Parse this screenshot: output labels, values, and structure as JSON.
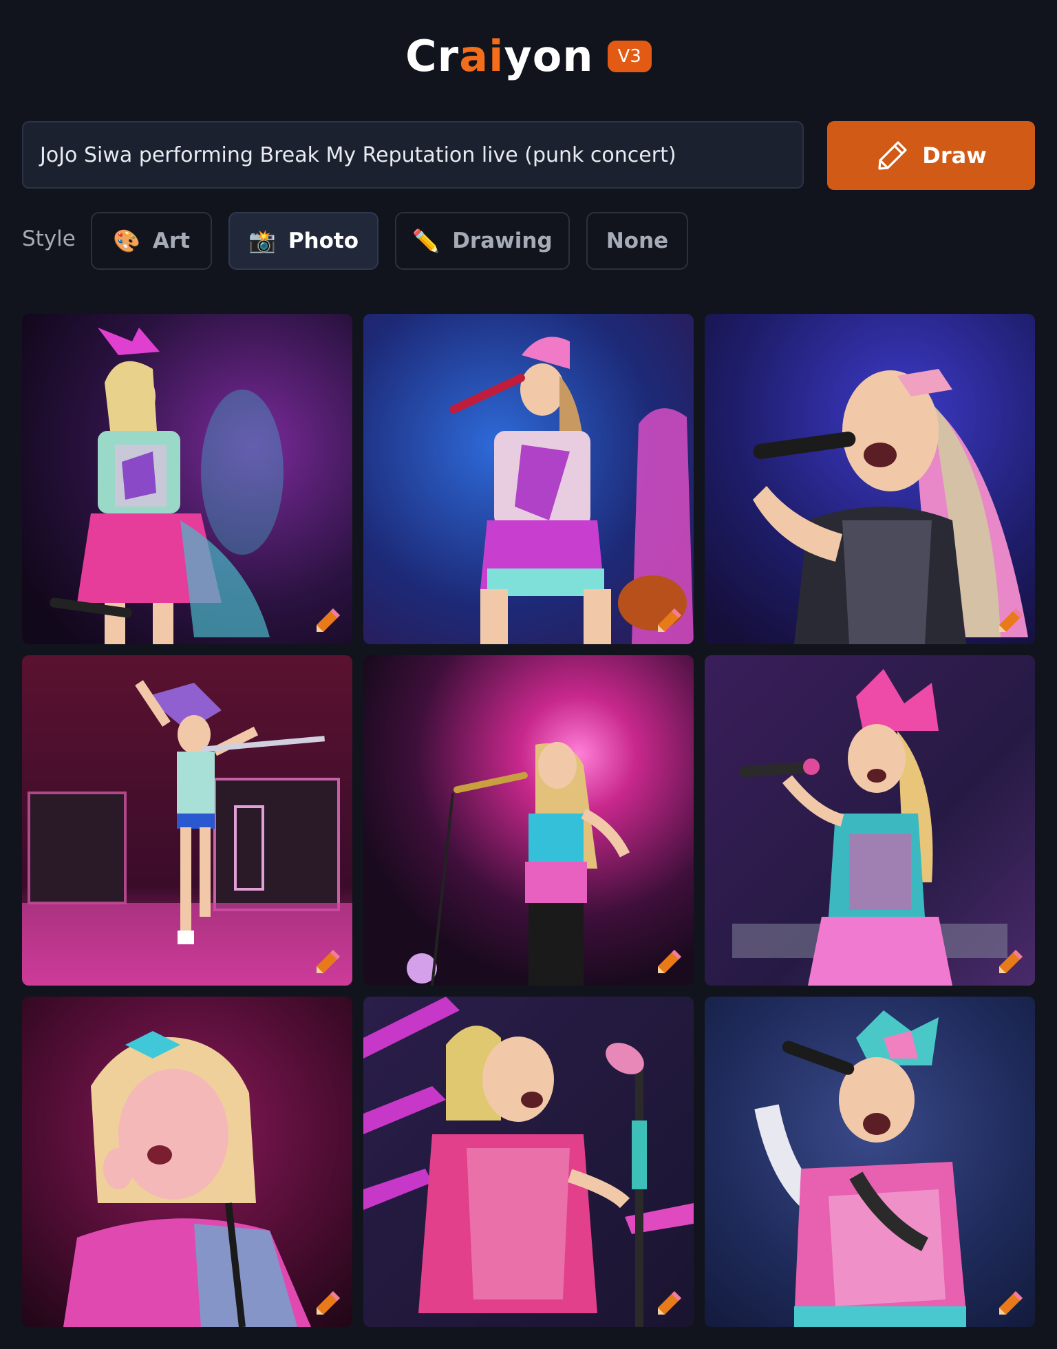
{
  "header": {
    "logo_part1": "Cr",
    "logo_accent": "ai",
    "logo_part2": "yon",
    "version": "V3"
  },
  "prompt": {
    "value": "JoJo Siwa performing Break My Reputation live (punk concert)"
  },
  "draw_button": {
    "label": "Draw",
    "color": "#d05a16"
  },
  "style": {
    "label": "Style",
    "options": [
      {
        "emoji": "🎨",
        "label": "Art",
        "selected": false
      },
      {
        "emoji": "📸",
        "label": "Photo",
        "selected": true
      },
      {
        "emoji": "✏️",
        "label": "Drawing",
        "selected": false
      },
      {
        "emoji": "",
        "label": "None",
        "selected": false
      }
    ]
  },
  "images": [
    {
      "icon": "pencil-icon"
    },
    {
      "icon": "pencil-icon"
    },
    {
      "icon": "pencil-icon"
    },
    {
      "icon": "pencil-icon"
    },
    {
      "icon": "pencil-icon"
    },
    {
      "icon": "pencil-icon"
    },
    {
      "icon": "pencil-icon"
    },
    {
      "icon": "pencil-icon"
    },
    {
      "icon": "pencil-icon"
    }
  ],
  "colors": {
    "background": "#11141c",
    "accent": "#f46d1b",
    "badge": "#e35a14"
  }
}
